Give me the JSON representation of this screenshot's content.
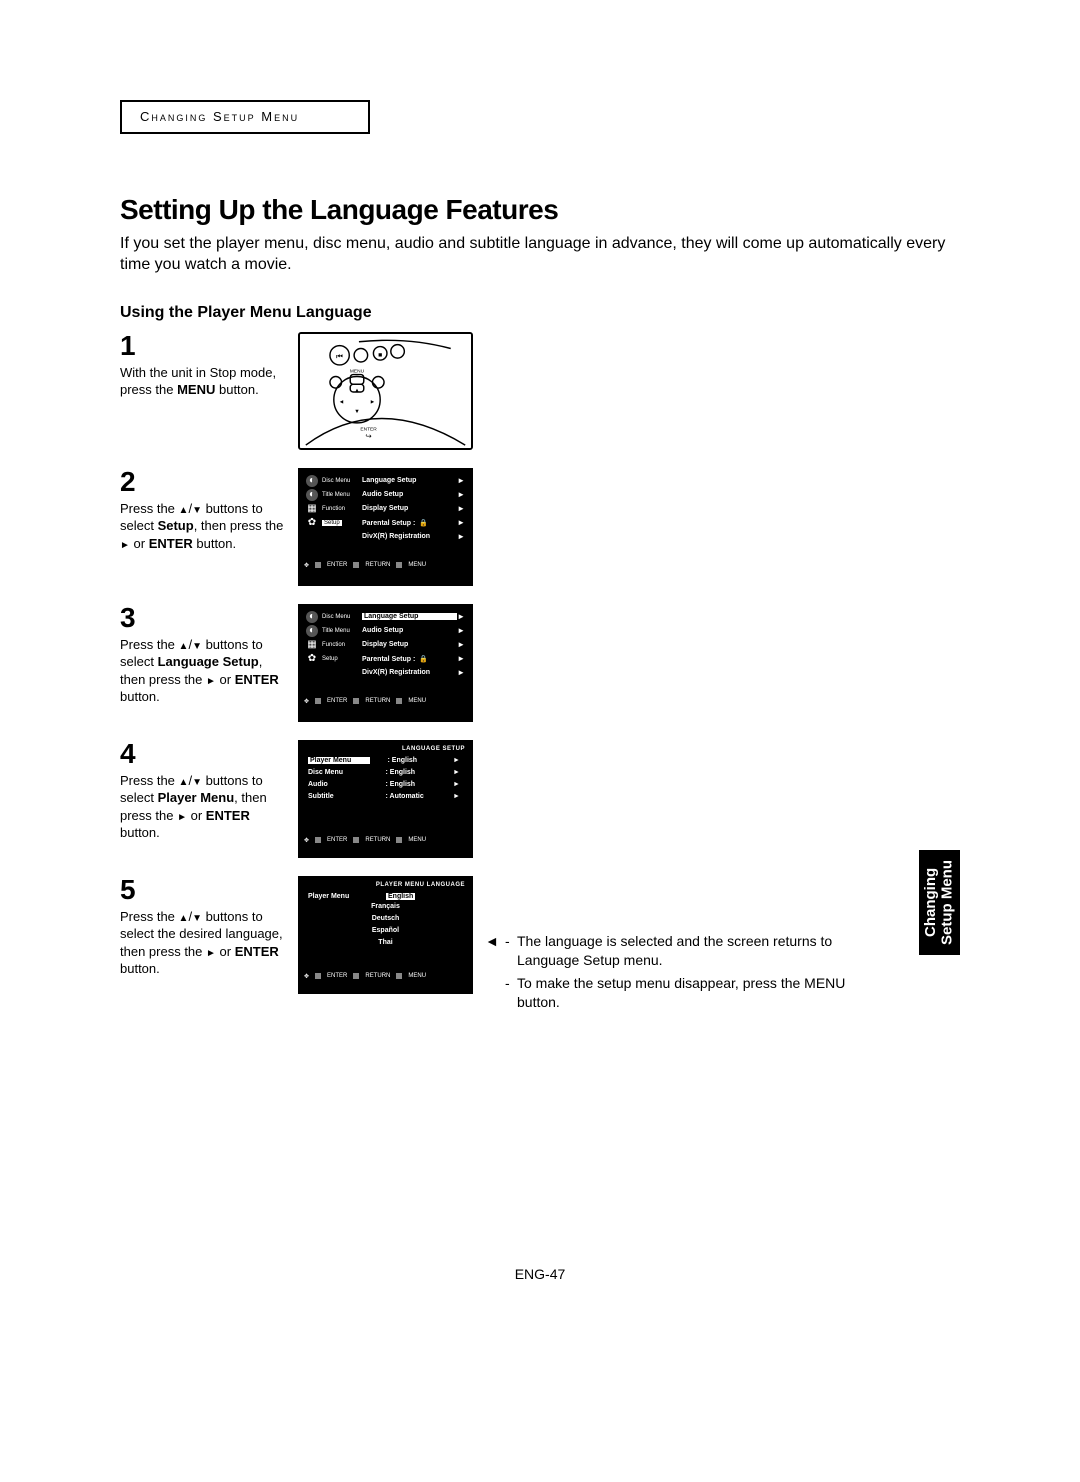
{
  "header_label": "Changing Setup Menu",
  "title": "Setting Up the Language Features",
  "intro": "If you set the player menu, disc menu, audio and subtitle language in advance, they will come up automatically every time you watch a movie.",
  "subhead": "Using the Player Menu Language",
  "steps": {
    "1": {
      "num": "1",
      "text_pre": "With the unit in Stop mode, press the ",
      "text_bold": "MENU",
      "text_post": " button."
    },
    "2": {
      "num": "2",
      "line1_pre": "Press the ",
      "line1_post": " buttons to select ",
      "line1_bold": "Setup",
      "line1_end": ", then press the ",
      "line2_post": " or ",
      "line2_bold": "ENTER",
      "line2_end": " button."
    },
    "3": {
      "num": "3",
      "line1_pre": "Press the ",
      "line1_post": " buttons to select ",
      "line1_bold": "Language Setup",
      "line1_end": ", then press the ",
      "line2_post": " or ",
      "line2_bold": "ENTER",
      "line2_end": " button."
    },
    "4": {
      "num": "4",
      "line1_pre": "Press the ",
      "line1_post": " buttons to select ",
      "line1_bold": "Player Menu",
      "line1_end": ", then press the ",
      "line2_post": " or ",
      "line2_bold": "ENTER",
      "line2_end": " button."
    },
    "5": {
      "num": "5",
      "line1_pre": "Press the ",
      "line1_post": " buttons to select the desired language, then press the ",
      "line2_post": " or ",
      "line2_bold": "ENTER",
      "line2_end": " button."
    }
  },
  "remote_labels": {
    "menu": "MENU",
    "enter": "ENTER"
  },
  "osd": {
    "sidebar": {
      "disc_menu": "Disc Menu",
      "title_menu": "Title Menu",
      "function": "Function",
      "setup": "Setup"
    },
    "items": {
      "language_setup": "Language Setup",
      "audio_setup": "Audio Setup",
      "display_setup": "Display Setup",
      "parental_setup": "Parental Setup :",
      "divx": "DivX(R) Registration"
    },
    "footer": {
      "enter": "ENTER",
      "return": "RETURN",
      "menu": "MENU"
    },
    "lang_setup_title": "LANGUAGE SETUP",
    "lang_setup": {
      "player_menu": "Player Menu",
      "disc_menu": "Disc Menu",
      "audio": "Audio",
      "subtitle": "Subtitle",
      "val_english": ": English",
      "val_automatic": ": Automatic"
    },
    "player_menu_lang_title": "PLAYER MENU LANGUAGE",
    "player_menu_label": "Player Menu",
    "languages": {
      "english": "English",
      "francais": "Français",
      "deutsch": "Deutsch",
      "espanol": "Español",
      "thai": "Thai"
    }
  },
  "notes": {
    "n1": "The language is selected and the screen returns to Language Setup menu.",
    "n2": "To make the setup menu disappear, press the MENU button."
  },
  "side_tab": {
    "line1": "Changing",
    "line2": "Setup Menu"
  },
  "page_number": "ENG-47"
}
